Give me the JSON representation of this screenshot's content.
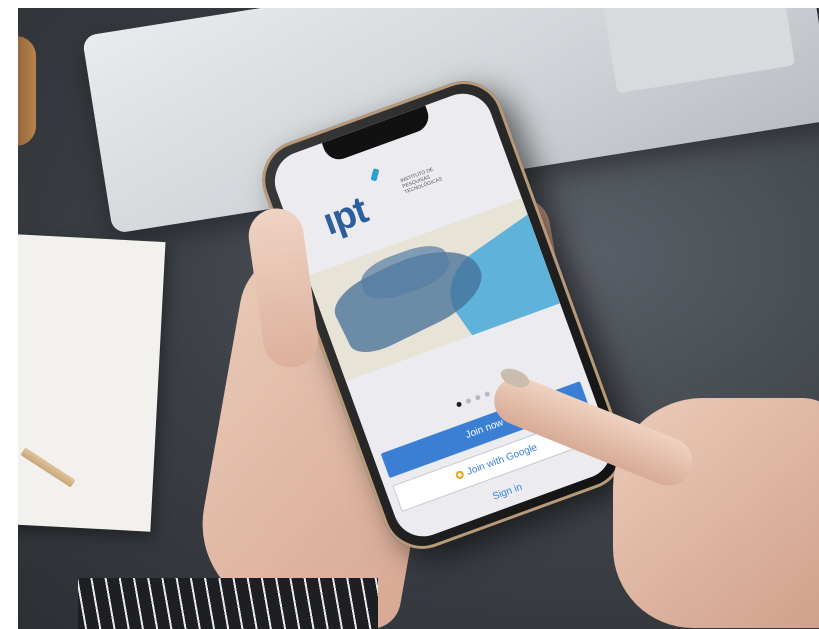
{
  "app": {
    "logo_text": "ıpt",
    "institute_lines": [
      "INSTITUTO DE",
      "PESQUISAS",
      "TECNOLÓGICAS"
    ]
  },
  "carousel": {
    "page_count": 4,
    "active_index": 0
  },
  "buttons": {
    "join_now": "Join now",
    "join_google": "Join with Google",
    "sign_in": "Sign in"
  },
  "colors": {
    "brand_blue": "#2b5f9e",
    "button_blue": "#3b7fd4",
    "sea": "#5fb3db"
  },
  "icons": {
    "google": "google-icon"
  }
}
